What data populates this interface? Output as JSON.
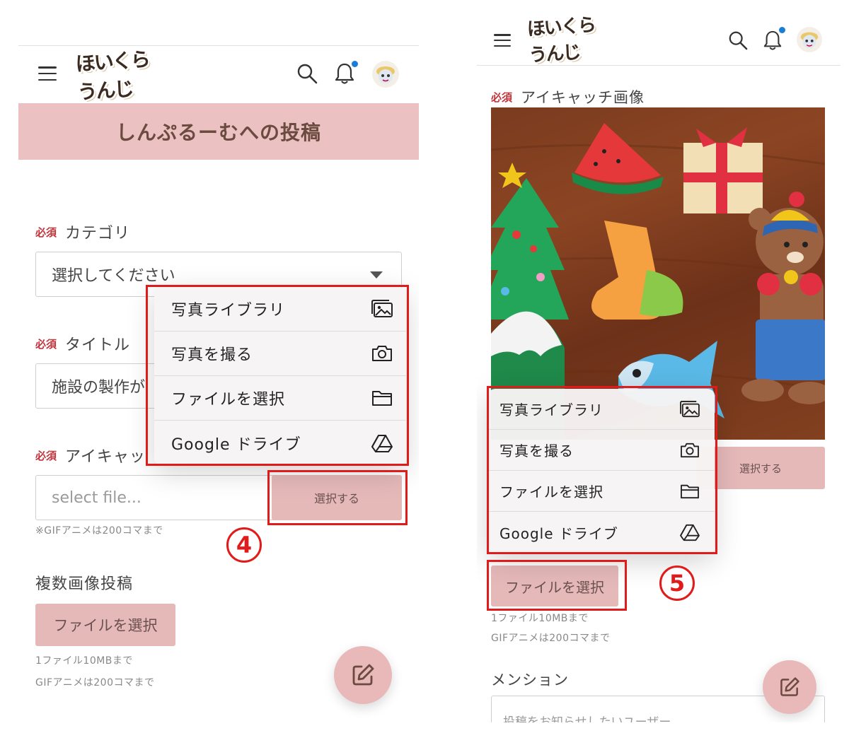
{
  "common": {
    "logo_text": "ほいくらうんじ",
    "menu_items": [
      {
        "label": "写真ライブラリ",
        "icon": "photo-library-icon"
      },
      {
        "label": "写真を撮る",
        "icon": "camera-icon"
      },
      {
        "label": "ファイルを選択",
        "icon": "folder-icon"
      },
      {
        "label": "Google ドライブ",
        "icon": "google-drive-icon"
      }
    ],
    "required_badge": "必須",
    "accent_color": "#e6b9b9",
    "highlight_color": "#e11a1a",
    "notification_dot_color": "#1a7ed6"
  },
  "left": {
    "page_title": "しんぷるーむへの投稿",
    "category": {
      "label": "カテゴリ",
      "value": "選択してください"
    },
    "title_field": {
      "label": "タイトル",
      "value": "施設の製作が"
    },
    "eyecatch": {
      "label": "アイキャッ",
      "placeholder": "select file...",
      "button": "選択する",
      "note": "※GIFアニメは200コマまで"
    },
    "multi_upload": {
      "label": "複数画像投稿",
      "button": "ファイルを選択",
      "note1": "1ファイル10MBまで",
      "note2": "GIFアニメは200コマまで"
    },
    "step": "4"
  },
  "right": {
    "eyecatch_label": "アイキャッチ画像",
    "select_button": "選択する",
    "file_button": "ファイルを選択",
    "note1": "1ファイル10MBまで",
    "note2": "GIFアニメは200コマまで",
    "mention_label": "メンション",
    "mention_placeholder": "投稿をお知らせしたいユーザー",
    "step": "5"
  }
}
